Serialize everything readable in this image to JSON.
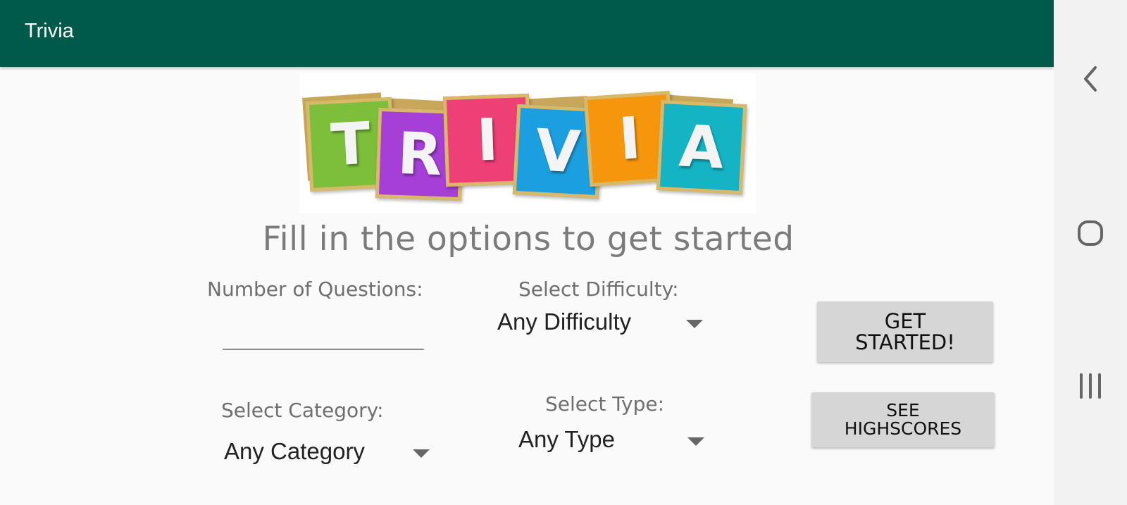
{
  "appbar": {
    "title": "Trivia"
  },
  "logo": {
    "letters": [
      "T",
      "R",
      "I",
      "V",
      "I",
      "A"
    ]
  },
  "heading": "Fill in the options to get started",
  "form": {
    "num_questions_label": "Number of Questions:",
    "num_questions_value": "",
    "difficulty_label": "Select Difficulty:",
    "difficulty_value": "Any Difficulty",
    "category_label": "Select Category:",
    "category_value": "Any Category",
    "type_label": "Select Type:",
    "type_value": "Any Type"
  },
  "buttons": {
    "get_started_line1": "GET",
    "get_started_line2": "STARTED!",
    "highscores_line1": "SEE",
    "highscores_line2": "HIGHSCORES"
  },
  "nav": {
    "icons": [
      "back-icon",
      "home-icon",
      "recents-icon"
    ]
  },
  "colors": {
    "appbar": "#005a4c",
    "tile_green": "#7cbf3a",
    "tile_purple": "#a53fd6",
    "tile_pink": "#ee3f76",
    "tile_blue": "#1c9fe0",
    "tile_orange": "#f6960c",
    "tile_teal": "#14b4c5"
  }
}
